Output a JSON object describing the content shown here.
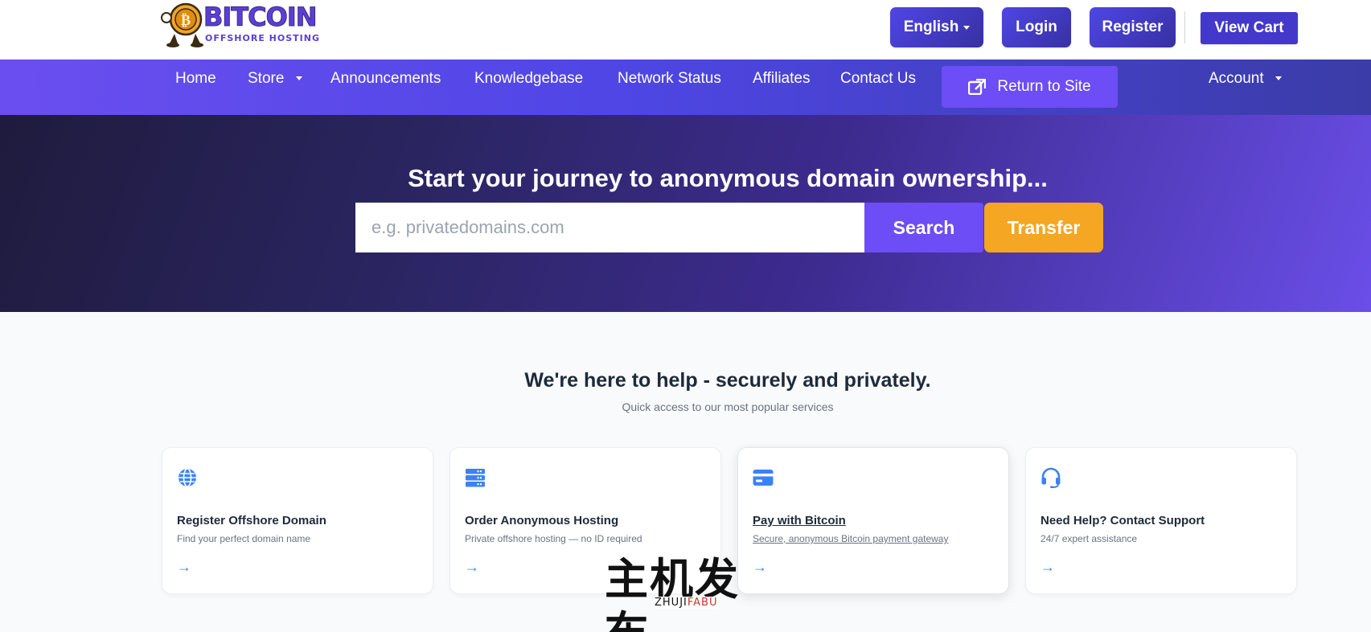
{
  "header": {
    "logo_main": "BITCOIN",
    "logo_sub": "OFFSHORE HOSTING",
    "language_label": "English",
    "login_label": "Login",
    "register_label": "Register",
    "cart_label": "View Cart"
  },
  "nav": {
    "items": [
      {
        "label": "Home"
      },
      {
        "label": "Store"
      },
      {
        "label": "Announcements"
      },
      {
        "label": "Knowledgebase"
      },
      {
        "label": "Network Status"
      },
      {
        "label": "Affiliates"
      },
      {
        "label": "Contact Us"
      }
    ],
    "return_label": "Return to Site",
    "account_label": "Account"
  },
  "hero": {
    "title": "Start your journey to anonymous domain ownership...",
    "search_placeholder": "e.g. privatedomains.com",
    "search_button": "Search",
    "transfer_button": "Transfer"
  },
  "help": {
    "title": "We're here to help - securely and privately.",
    "subtitle": "Quick access to our most popular services",
    "cards": [
      {
        "title": "Register Offshore Domain",
        "desc": "Find your perfect domain name",
        "icon": "globe-icon",
        "arrow": "→"
      },
      {
        "title": "Order Anonymous Hosting",
        "desc": "Private offshore hosting — no ID required",
        "icon": "server-icon",
        "arrow": "→"
      },
      {
        "title": "Pay with Bitcoin",
        "desc": "Secure, anonymous Bitcoin payment gateway",
        "icon": "credit-card-icon",
        "arrow": "→"
      },
      {
        "title": "Need Help? Contact Support",
        "desc": "24/7 expert assistance",
        "icon": "headset-icon",
        "arrow": "→"
      }
    ]
  },
  "watermark": {
    "zh": "主机发布",
    "en_a": "ZHUJI",
    "en_b": "FABU"
  },
  "colors": {
    "brand_purple": "#6d4df5",
    "transfer_orange": "#f5a623",
    "icon_blue": "#3b82f6"
  }
}
